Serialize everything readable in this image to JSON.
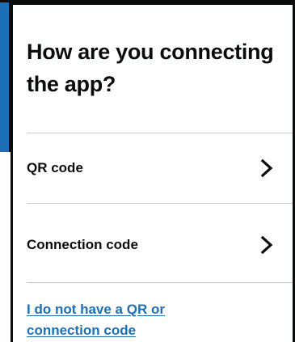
{
  "screen": {
    "heading": "How are you connecting the app?"
  },
  "options": [
    {
      "label": "QR code",
      "icon": "chevron-right-icon"
    },
    {
      "label": "Connection code",
      "icon": "chevron-right-icon"
    }
  ],
  "help_link": {
    "label": "I do not have a QR or connection code"
  },
  "colors": {
    "text": "#0b0c0c",
    "link": "#1d70b8",
    "divider": "#c7cacc",
    "background": "#ffffff"
  }
}
